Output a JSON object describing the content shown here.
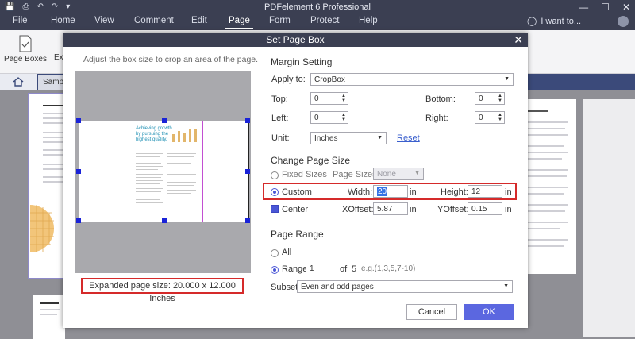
{
  "app": {
    "title": "PDFelement 6 Professional",
    "tabs": [
      "File",
      "Home",
      "View",
      "Comment",
      "Edit",
      "Page",
      "Form",
      "Protect",
      "Help"
    ],
    "active_tab": "Page",
    "search_label": "I want to..."
  },
  "toolbar": {
    "page_boxes_label": "Page Boxes",
    "cut_label": "Ex"
  },
  "doc_tab": {
    "label": "Samp"
  },
  "dialog": {
    "title": "Set Page Box",
    "hint": "Adjust the box size to crop an area of the page.",
    "preview_text": "Achieving growth by pursuing the highest quality.",
    "expanded_size": "Expanded page size: 20.000 x 12.000 Inches",
    "margin": {
      "heading": "Margin Setting",
      "apply_to_label": "Apply to:",
      "apply_to_value": "CropBox",
      "top_label": "Top:",
      "top_value": "0",
      "bottom_label": "Bottom:",
      "bottom_value": "0",
      "left_label": "Left:",
      "left_value": "0",
      "right_label": "Right:",
      "right_value": "0",
      "unit_label": "Unit:",
      "unit_value": "Inches",
      "reset_label": "Reset"
    },
    "page_size": {
      "heading": "Change Page Size",
      "fixed_label": "Fixed Sizes",
      "page_sizes_label": "Page Sizes:",
      "page_sizes_value": "None",
      "custom_label": "Custom",
      "width_label": "Width:",
      "width_value": "20",
      "height_label": "Height:",
      "height_value": "12",
      "unit": "in",
      "center_label": "Center",
      "xoffset_label": "XOffset:",
      "xoffset_value": "5.87",
      "yoffset_label": "YOffset:",
      "yoffset_value": "0.15"
    },
    "page_range": {
      "heading": "Page Range",
      "all_label": "All",
      "range_label": "Range:",
      "range_from": "1",
      "of_label": "of",
      "total": "5",
      "range_hint": "e.g.(1,3,5,7-10)",
      "subset_label": "Subset:",
      "subset_value": "Even and odd pages"
    },
    "cancel_label": "Cancel",
    "ok_label": "OK"
  },
  "colors": {
    "titlebar": "#3b3f52",
    "accent": "#5b67e0",
    "highlight": "#d52a2a",
    "handle": "#1a23d8"
  }
}
